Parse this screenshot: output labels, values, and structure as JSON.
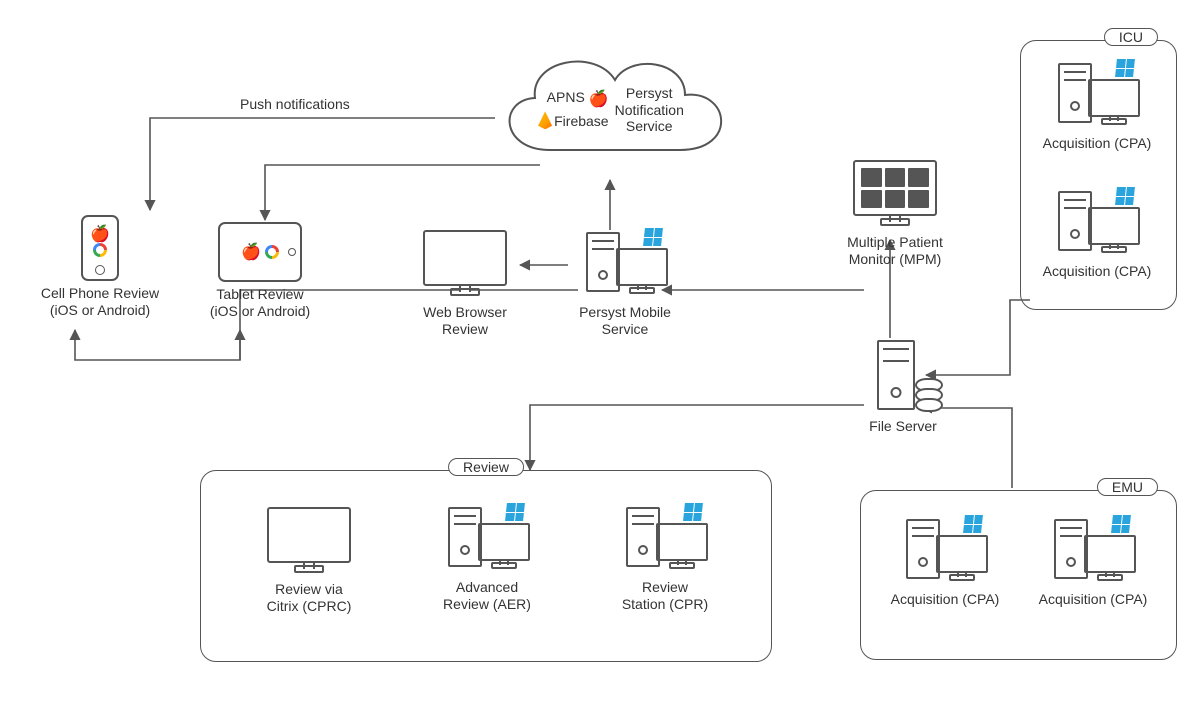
{
  "push_label": "Push notifications",
  "cloud": {
    "apns": "APNS",
    "firebase": "Firebase",
    "service_l1": "Persyst",
    "service_l2": "Notification",
    "service_l3": "Service"
  },
  "nodes": {
    "phone_l1": "Cell Phone Review",
    "phone_l2": "(iOS or Android)",
    "tablet_l1": "Tablet Review",
    "tablet_l2": "(iOS or Android)",
    "web_l1": "Web Browser",
    "web_l2": "Review",
    "pms_l1": "Persyst Mobile",
    "pms_l2": "Service",
    "mpm_l1": "Multiple Patient",
    "mpm_l2": "Monitor (MPM)",
    "fileserver": "File Server",
    "citrix_l1": "Review via",
    "citrix_l2": "Citrix (CPRC)",
    "aer_l1": "Advanced",
    "aer_l2": "Review (AER)",
    "cpr_l1": "Review",
    "cpr_l2": "Station (CPR)",
    "cpa": "Acquisition (CPA)"
  },
  "groups": {
    "icu": "ICU",
    "emu": "EMU",
    "review": "Review"
  }
}
